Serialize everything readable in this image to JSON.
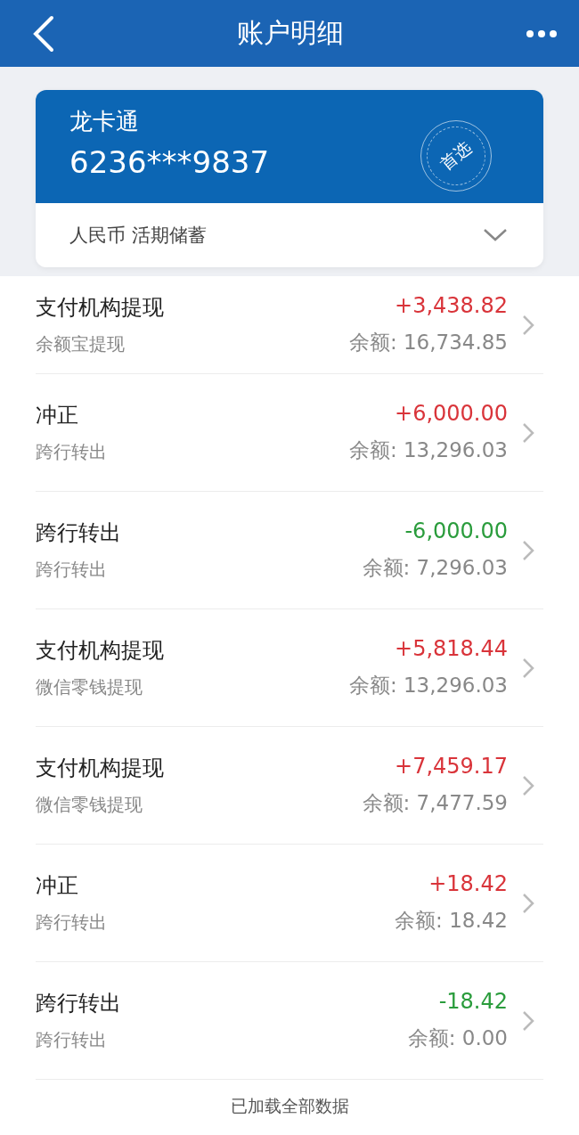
{
  "header": {
    "title": "账户明细"
  },
  "card": {
    "name": "龙卡通",
    "number": "6236***9837",
    "badge": "首选",
    "account": "人民币 活期储蓄"
  },
  "transactions": [
    {
      "title": "支付机构提现",
      "subtitle": "余额宝提现",
      "amount": "+3,438.82",
      "kind": "credit",
      "balance": "余额: 16,734.85"
    },
    {
      "title": "冲正",
      "subtitle": "跨行转出",
      "amount": "+6,000.00",
      "kind": "credit",
      "balance": "余额: 13,296.03"
    },
    {
      "title": "跨行转出",
      "subtitle": "跨行转出",
      "amount": "-6,000.00",
      "kind": "debit",
      "balance": "余额: 7,296.03"
    },
    {
      "title": "支付机构提现",
      "subtitle": "微信零钱提现",
      "amount": "+5,818.44",
      "kind": "credit",
      "balance": "余额: 13,296.03"
    },
    {
      "title": "支付机构提现",
      "subtitle": "微信零钱提现",
      "amount": "+7,459.17",
      "kind": "credit",
      "balance": "余额: 7,477.59"
    },
    {
      "title": "冲正",
      "subtitle": "跨行转出",
      "amount": "+18.42",
      "kind": "credit",
      "balance": "余额: 18.42"
    },
    {
      "title": "跨行转出",
      "subtitle": "跨行转出",
      "amount": "-18.42",
      "kind": "debit",
      "balance": "余额: 0.00"
    }
  ],
  "footer": "已加载全部数据"
}
